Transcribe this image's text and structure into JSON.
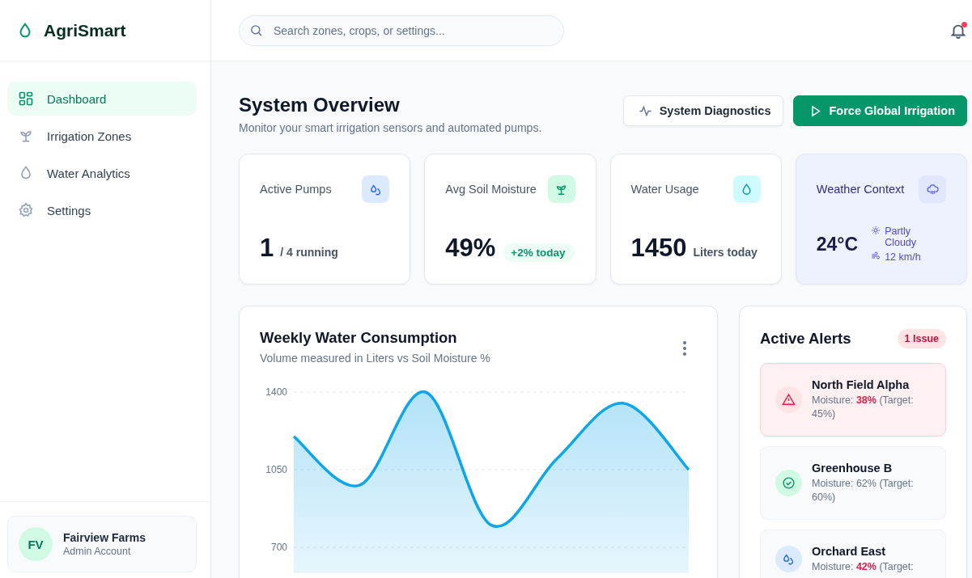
{
  "brand": {
    "name": "AgriSmart"
  },
  "nav": [
    {
      "label": "Dashboard",
      "selected": true
    },
    {
      "label": "Irrigation Zones",
      "selected": false
    },
    {
      "label": "Water Analytics",
      "selected": false
    },
    {
      "label": "Settings",
      "selected": false
    }
  ],
  "user": {
    "initials": "FV",
    "name": "Fairview Farms",
    "role": "Admin Account"
  },
  "header": {
    "search": {
      "placeholder": "Search zones, crops, or settings..."
    },
    "notifications": {
      "unread": true
    }
  },
  "page": {
    "title": "System Overview",
    "subtitle": "Monitor your smart irrigation sensors and automated pumps."
  },
  "actions": [
    {
      "label": "System Diagnostics",
      "kind": "secondary"
    },
    {
      "label": "Force Global Irrigation",
      "kind": "primary"
    }
  ],
  "stats": [
    {
      "kind": "pumps",
      "title": "Active Pumps",
      "value": "1",
      "unit": "/ 4 running"
    },
    {
      "kind": "moisture",
      "title": "Avg Soil Moisture",
      "value": "49%",
      "badge": "+2% today"
    },
    {
      "kind": "usage",
      "title": "Water Usage",
      "value": "1450",
      "unit": "Liters today"
    },
    {
      "kind": "weather",
      "title": "Weather Context",
      "value": "24°C",
      "condition": "Partly Cloudy",
      "wind": "12 km/h"
    }
  ],
  "chart_card": {
    "title": "Weekly Water Consumption",
    "subtitle": "Volume measured in Liters vs Soil Moisture %",
    "chart_data": {
      "type": "area",
      "grid": true,
      "ylim": [
        700,
        1400
      ],
      "yticks": [
        700,
        1050,
        1400
      ],
      "series": [
        {
          "color": "#0ea5e9",
          "values": [
            1200,
            980,
            1400,
            800,
            1100,
            1350,
            1050
          ]
        }
      ]
    }
  },
  "alerts": {
    "title": "Active Alerts",
    "badge": "1 Issue",
    "items": [
      {
        "name": "North Field Alpha",
        "kind": "critical",
        "label": "Moisture:",
        "moisture": "38%",
        "target": "(Target: 45%)"
      },
      {
        "name": "Greenhouse B",
        "kind": "ok",
        "label": "Moisture:",
        "moisture": "62%",
        "target": "(Target: 60%)"
      },
      {
        "name": "Orchard East",
        "kind": "watch",
        "label": "Moisture:",
        "moisture": "42%",
        "target": "(Target:"
      }
    ]
  }
}
